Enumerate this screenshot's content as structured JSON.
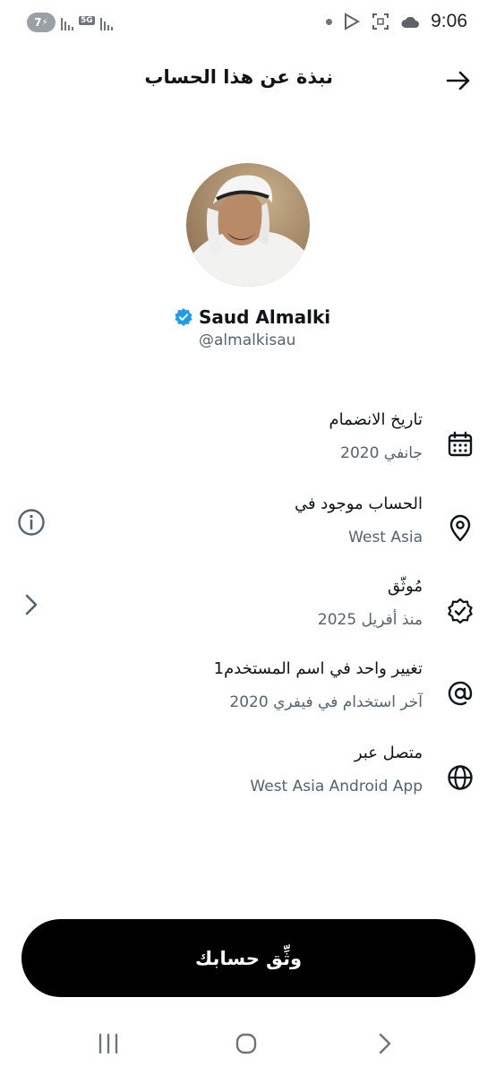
{
  "status_bar": {
    "battery": "7",
    "network": "5G",
    "time": "9:06"
  },
  "header": {
    "title": "نبذة عن هذا الحساب",
    "back_icon": "arrow-right-icon"
  },
  "profile": {
    "name": "Saud Almalki",
    "handle": "@almalkisau",
    "verified_color": "#1d9bf0"
  },
  "rows": [
    {
      "title": "تاريخ الانضمام",
      "subtitle": "جانفي 2020",
      "icon": "calendar-icon"
    },
    {
      "title": "الحساب موجود في",
      "subtitle": "West Asia",
      "icon": "location-pin-icon"
    },
    {
      "title": "مُوثّق",
      "subtitle": "منذ أفريل 2025",
      "icon": "verified-badge-icon"
    },
    {
      "title": "تغيير واحد في اسم المستخدم1",
      "subtitle": "آخر استخدام في فيفري 2020",
      "icon": "at-sign-icon"
    },
    {
      "title": "متصل عبر",
      "subtitle": "West Asia Android App",
      "icon": "globe-icon"
    }
  ],
  "verify_button": {
    "label": "وثِّق حسابك"
  },
  "colors": {
    "text": "#0f1419",
    "secondary_text": "#536471",
    "button_bg": "#000000",
    "button_text": "#ffffff"
  }
}
